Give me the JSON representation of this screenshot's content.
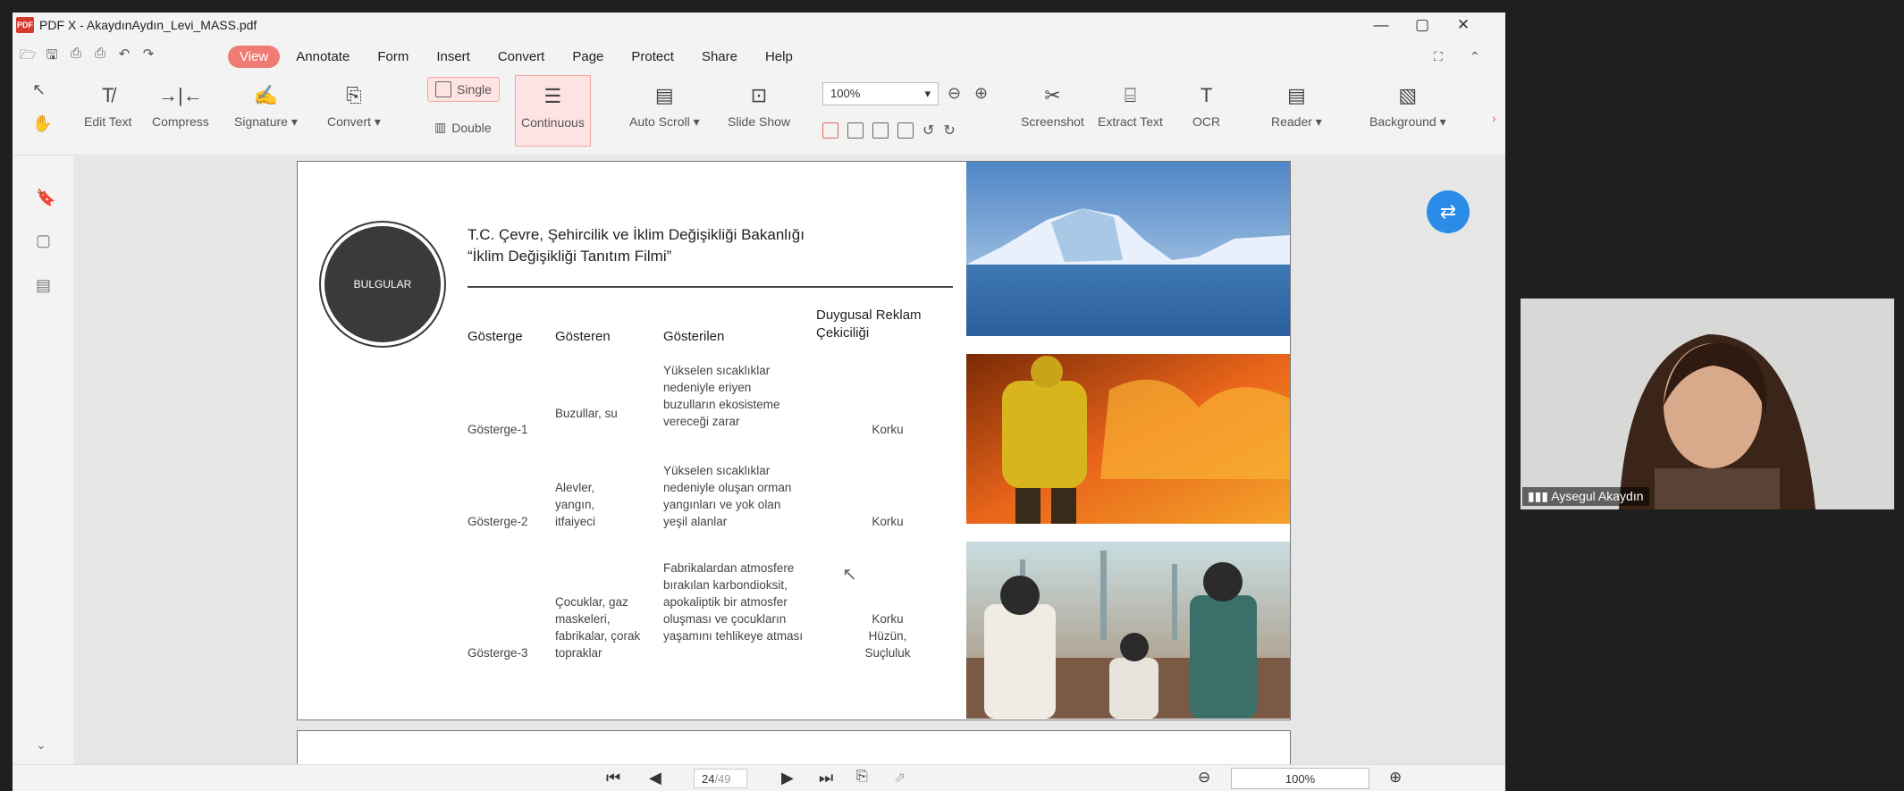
{
  "window": {
    "title": "PDF X - AkaydınAydın_Levi_MASS.pdf",
    "app_badge": "PDF"
  },
  "menu": [
    "View",
    "Annotate",
    "Form",
    "Insert",
    "Convert",
    "Page",
    "Protect",
    "Share",
    "Help"
  ],
  "active_menu": "View",
  "ribbon": {
    "edit_text": "Edit Text",
    "compress": "Compress",
    "signature": "Signature ▾",
    "convert": "Convert ▾",
    "single": "Single",
    "double": "Double",
    "continuous": "Continuous",
    "auto_scroll": "Auto Scroll ▾",
    "slide_show": "Slide Show",
    "zoom": "100%",
    "screenshot": "Screenshot",
    "extract_text": "Extract Text",
    "ocr": "OCR",
    "reader": "Reader ▾",
    "background": "Background ▾"
  },
  "page": {
    "circle_label": "BULGULAR",
    "title_line1": "T.C. Çevre, Şehircilik ve İklim Değişikliği Bakanlığı",
    "title_line2": "“İklim Değişikliği Tanıtım Filmi”",
    "headers": [
      "Gösterge",
      "Gösteren",
      "Gösterilen",
      "Duygusal Reklam Çekiciliği"
    ],
    "rows": [
      {
        "gosterge": "Gösterge-1",
        "gosteren": "Buzullar, su",
        "gosterilen": "Yükselen sıcaklıklar nedeniyle eriyen buzulların ekosisteme vereceği zarar",
        "duygu": "Korku"
      },
      {
        "gosterge": "Gösterge-2",
        "gosteren": "Alevler, yangın, itfaiyeci",
        "gosterilen": "Yükselen sıcaklıklar nedeniyle oluşan orman yangınları ve yok olan yeşil alanlar",
        "duygu": "Korku"
      },
      {
        "gosterge": "Gösterge-3",
        "gosteren": "Çocuklar, gaz maskeleri, fabrikalar, çorak topraklar",
        "gosterilen": "Fabrikalardan atmosfere bırakılan karbondioksit, apokaliptik bir atmosfer oluşması ve çocukların yaşamını tehlikeye atması",
        "duygu": "Korku Hüzün, Suçluluk"
      }
    ]
  },
  "status": {
    "page_current": "24",
    "page_total": "/49",
    "zoom": "100%"
  },
  "video": {
    "participant": "Aysegul Akaydın"
  }
}
